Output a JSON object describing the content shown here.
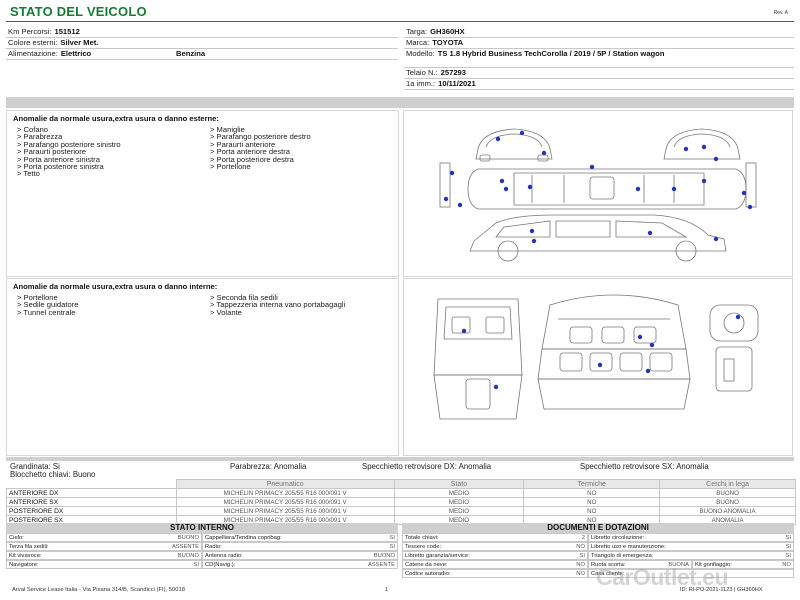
{
  "header": {
    "title": "STATO DEL VEICOLO",
    "rev": "Rev. A"
  },
  "vehicle": {
    "km_label": "Km Percorsi:",
    "km_value": "151512",
    "color_label": "Colore esterni:",
    "color_value": "Silver Met.",
    "fuel_label": "Alimentazione:",
    "fuel_value": "Elettrico",
    "fuel_value2": "Benzina",
    "plate_label": "Targa:",
    "plate_value": "GH360HX",
    "brand_label": "Marca:",
    "brand_value": "TOYOTA",
    "model_label": "Modello:",
    "model_value": "TS 1.8 Hybrid Business TechCorolla / 2019 / 5P / Station wagon",
    "chassis_label": "Telaio N.:",
    "chassis_value": "257293",
    "reg_label": "1a imm.:",
    "reg_value": "10/11/2021"
  },
  "external": {
    "title": "Anomalie da normale usura,extra usura o danno esterne:",
    "col1": [
      "> Cofano",
      "> Parabrezza",
      "> Parafango posteriore sinistro",
      "> Paraurti posteriore",
      "> Porta anteriore sinistra",
      "> Porta posteriore sinistra",
      "> Tetto"
    ],
    "col2": [
      "> Maniglie",
      "> Parafango posteriore destro",
      "> Paraurti anteriore",
      "> Porta anteriore destra",
      "> Porta posteriore destra",
      "> Portellone"
    ]
  },
  "internal": {
    "title": "Anomalie da normale usura,extra usura o danno interne:",
    "col1": [
      "> Portellone",
      "> Sedile guidatore",
      "> Tunnel centrale"
    ],
    "col2": [
      "> Seconda fila sedili",
      "> Tappezzeria interna vano portabagagli",
      "> Volante"
    ]
  },
  "summary": {
    "hail": "Grandinata: Si",
    "locks": "Blocchetto chiavi: Buono",
    "windshield": "Parabrezza: Anomalia",
    "mirror_dx": "Specchietto retrovisore DX: Anomalia",
    "mirror_sx": "Specchietto retrovisore SX: Anomalia"
  },
  "tyres": {
    "headers": [
      "Pneumatico",
      "Stato",
      "Termiche",
      "Cerchi in lega"
    ],
    "rows": [
      {
        "pos": "ANTERIORE DX",
        "tyre": "MICHELIN PRIMACY  205/55 R16 000/091 V",
        "state": "MEDIO",
        "winter": "NO",
        "rims": "BUONO"
      },
      {
        "pos": "ANTERIORE SX",
        "tyre": "MICHELIN PRIMACY  205/55 R16 000/091 V",
        "state": "MEDIO",
        "winter": "NO",
        "rims": "BUONO"
      },
      {
        "pos": "POSTERIORE DX",
        "tyre": "MICHELIN PRIMACY  205/55 R16 000/091 V",
        "state": "MEDIO",
        "winter": "NO",
        "rims": "BUONO ANOMALIA"
      },
      {
        "pos": "POSTERIORE SX",
        "tyre": "MICHELIN PRIMACY  205/55 R16 000/091 V",
        "state": "MEDIO",
        "winter": "NO",
        "rims": "ANOMALIA"
      }
    ]
  },
  "interior_state": {
    "title": "STATO INTERNO",
    "rows": [
      [
        "Cielo:",
        "BUONO",
        "Cappelliera/Tendina copribag:",
        "SI"
      ],
      [
        "Terza fila sedili:",
        "ASSENTE",
        "Radio:",
        "SI"
      ],
      [
        "Kit vivavoce:",
        "BUONO",
        "Antenna radio:",
        "BUONO"
      ],
      [
        "Navigatore:",
        "SI",
        "CD(Navig.):",
        "ASSENTE"
      ]
    ]
  },
  "documents": {
    "title": "DOCUMENTI E DOTAZIONI",
    "rows": [
      [
        "Totale chiavi:",
        "2",
        "Libretto circolazione:",
        "SI"
      ],
      [
        "Tessere code:",
        "NO",
        "Libretto uso e manutenzione:",
        "SI"
      ],
      [
        "Libretto garanzia/service:",
        "SI",
        "Triangolo di emergenza:",
        "SI"
      ],
      [
        "Catene da neve:",
        "NO",
        "Ruota scorta:",
        "BUONA",
        "Kit gonfiaggio:",
        "NO"
      ],
      [
        "Codice autoradio:",
        "NO",
        "Casa cliente:",
        ""
      ]
    ]
  },
  "footer": {
    "address": "Arval Service Lease Italia - Via Pisana 314/B, Scandicci (FI), 50018",
    "page": "1",
    "right": "ID: RI-PO-2021-1123 | GH360HX"
  },
  "watermark": "CarOutlet.eu"
}
